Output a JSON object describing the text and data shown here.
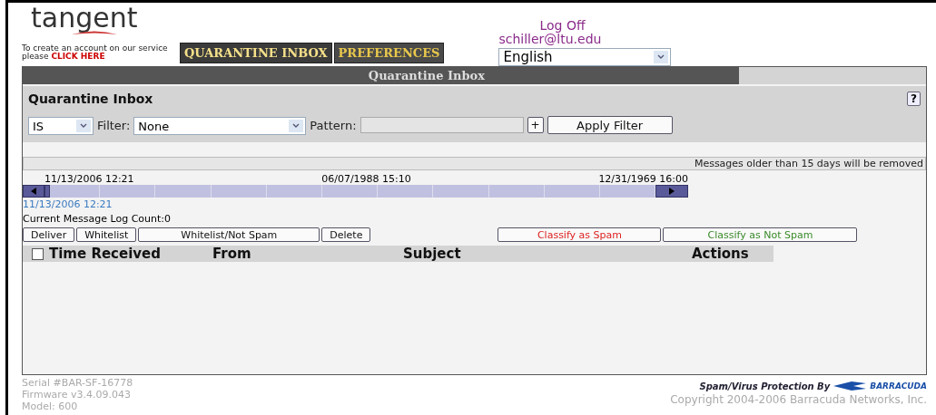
{
  "header": {
    "logo": "tangent",
    "account_note": "To create an account on our service please",
    "account_link": "CLICK HERE",
    "tabs": [
      {
        "label": "QUARANTINE INBOX",
        "selected": true
      },
      {
        "label": "PREFERENCES",
        "selected": false
      }
    ],
    "log_off": "Log Off",
    "user": "schiller@ltu.edu",
    "language": "English"
  },
  "panel_title": "Quarantine Inbox",
  "filter": {
    "heading": "Quarantine Inbox",
    "help": "?",
    "operator": "IS",
    "filter_label": "Filter:",
    "filter_value": "None",
    "pattern_label": "Pattern:",
    "add": "+",
    "apply": "Apply Filter"
  },
  "notice": "Messages older than 15 days will be removed",
  "timeline": {
    "dates": [
      "11/13/2006 12:21",
      "06/07/1988 15:10",
      "12/31/1969 16:00"
    ],
    "level": 0,
    "current": "11/13/2006 12:21"
  },
  "count": "Current Message Log Count:0",
  "actions": [
    {
      "label": "Deliver",
      "kind": "plain"
    },
    {
      "label": "Whitelist",
      "kind": "plain"
    },
    {
      "label": "Whitelist/Not Spam",
      "kind": "plain"
    },
    {
      "label": "Delete",
      "kind": "plain"
    },
    {
      "label": "Classify as Spam",
      "kind": "spam"
    },
    {
      "label": "Classify as Not Spam",
      "kind": "notspam"
    }
  ],
  "table": {
    "select_all": false,
    "columns": [
      "Time Received",
      "From",
      "Subject",
      "Actions"
    ]
  },
  "footer": {
    "info": [
      "Serial #BAR-SF-16778",
      "Firmware v3.4.09.043",
      "Model: 600"
    ],
    "protection": "Spam/Virus Protection By",
    "logo_text": "BARRACUDA",
    "copyright": "Copyright 2004-2006 Barracuda Networks, Inc."
  }
}
